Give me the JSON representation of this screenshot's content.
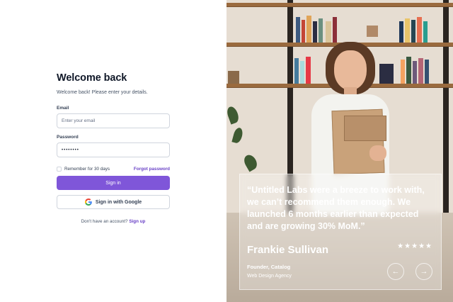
{
  "form": {
    "title": "Welcome back",
    "subtitle": "Welcome back! Please enter your details.",
    "email_label": "Email",
    "email_placeholder": "Enter your email",
    "password_label": "Password",
    "password_value": "••••••••",
    "remember_label": "Remember for 30 days",
    "forgot_label": "Forgot password",
    "signin_label": "Sign in",
    "google_label": "Sign in with Google",
    "signup_prompt": "Don't have an account?",
    "signup_label": "Sign up"
  },
  "testimonial": {
    "quote": "“Untitled Labs were a breeze to work with, we can’t recommend them enough. We launched 6 months earlier than expected and are growing 30% MoM.”",
    "name": "Frankie Sullivan",
    "stars": "★★★★★",
    "rating": 5,
    "role": "Founder, Catalog",
    "company": "Web Design Agency",
    "prev_icon": "arrow-left-icon",
    "next_icon": "arrow-right-icon"
  },
  "colors": {
    "primary": "#7f56d9",
    "link": "#6941c6",
    "heading": "#101828"
  }
}
